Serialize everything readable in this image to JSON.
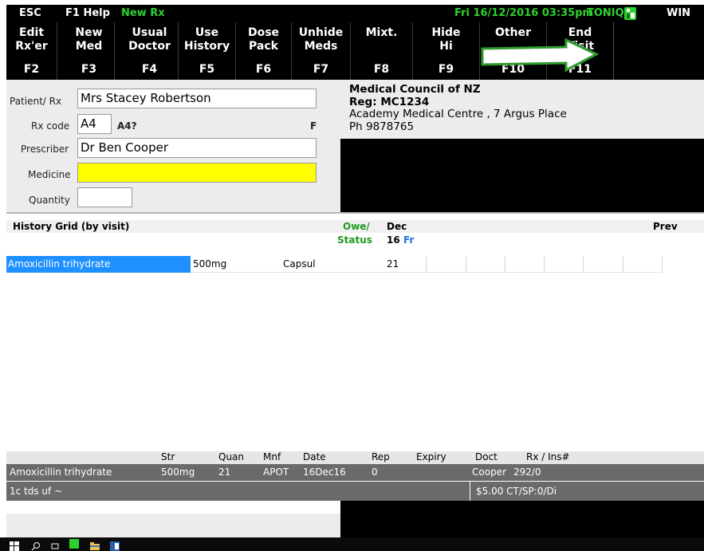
{
  "topbar": {
    "esc": "ESC",
    "help": "F1 Help",
    "mode": "New Rx",
    "datetime": "Fri 16/12/2016 03:35pm",
    "brand": "TONIQ",
    "win": "WIN"
  },
  "fkeys": [
    {
      "line1": "Edit",
      "line2": "Rx'er",
      "key": "F2"
    },
    {
      "line1": "New",
      "line2": "Med",
      "key": "F3"
    },
    {
      "line1": "Usual",
      "line2": "Doctor",
      "key": "F4"
    },
    {
      "line1": "Use",
      "line2": "History",
      "key": "F5"
    },
    {
      "line1": "Dose",
      "line2": "Pack",
      "key": "F6"
    },
    {
      "line1": "Unhide",
      "line2": "Meds",
      "key": "F7"
    },
    {
      "line1": "Mixt.",
      "line2": "",
      "key": "F8"
    },
    {
      "line1": "Hide",
      "line2": "Hi",
      "key": "F9"
    },
    {
      "line1": "Other",
      "line2": "",
      "key": "F10"
    },
    {
      "line1": "End",
      "line2": "Visit",
      "key": "F11"
    }
  ],
  "patient": {
    "patient_label": "Patient/ Rx",
    "patient_value": "Mrs Stacey Robertson",
    "rxcode_label": "Rx code",
    "rxcode_value": "A4",
    "rxcode_hint": "A4?",
    "flag": "F",
    "prescriber_label": "Prescriber",
    "prescriber_value": "Dr Ben Cooper",
    "medicine_label": "Medicine",
    "medicine_value": "",
    "quantity_label": "Quantity",
    "quantity_value": ""
  },
  "info": {
    "council": "Medical Council of NZ",
    "reg": "Reg: MC1234",
    "address": "Academy Medical Centre , 7 Argus Place",
    "phone": "Ph 9878765"
  },
  "history": {
    "title": "History Grid (by visit)",
    "owe": "Owe/",
    "status": "Status",
    "month": "Dec",
    "day": "16",
    "dayname": "Fr",
    "prev": "Prev",
    "rows": [
      {
        "name": "Amoxicillin trihydrate",
        "strength": "500mg",
        "form": "Capsul",
        "qty": "21"
      }
    ]
  },
  "detail": {
    "headers": {
      "str": "Str",
      "quan": "Quan",
      "mnf": "Mnf",
      "date": "Date",
      "rep": "Rep",
      "expiry": "Expiry",
      "doct": "Doct",
      "rxins": "Rx / Ins#"
    },
    "row": {
      "name": "Amoxicillin trihydrate",
      "str": "500mg",
      "quan": "21",
      "mnf": "APOT",
      "date": "16Dec16",
      "rep": "0",
      "expiry": "",
      "doct": "Cooper",
      "rxins": "292/0"
    },
    "instructions": "1c tds uf ~",
    "price": "$5.00 CT/SP:0/Di"
  },
  "colors": {
    "medicine_highlight": "#ffff00",
    "selected_row": "#1e90ff",
    "accent_green": "#2fd12f",
    "blue_text": "#1e6fe0"
  }
}
